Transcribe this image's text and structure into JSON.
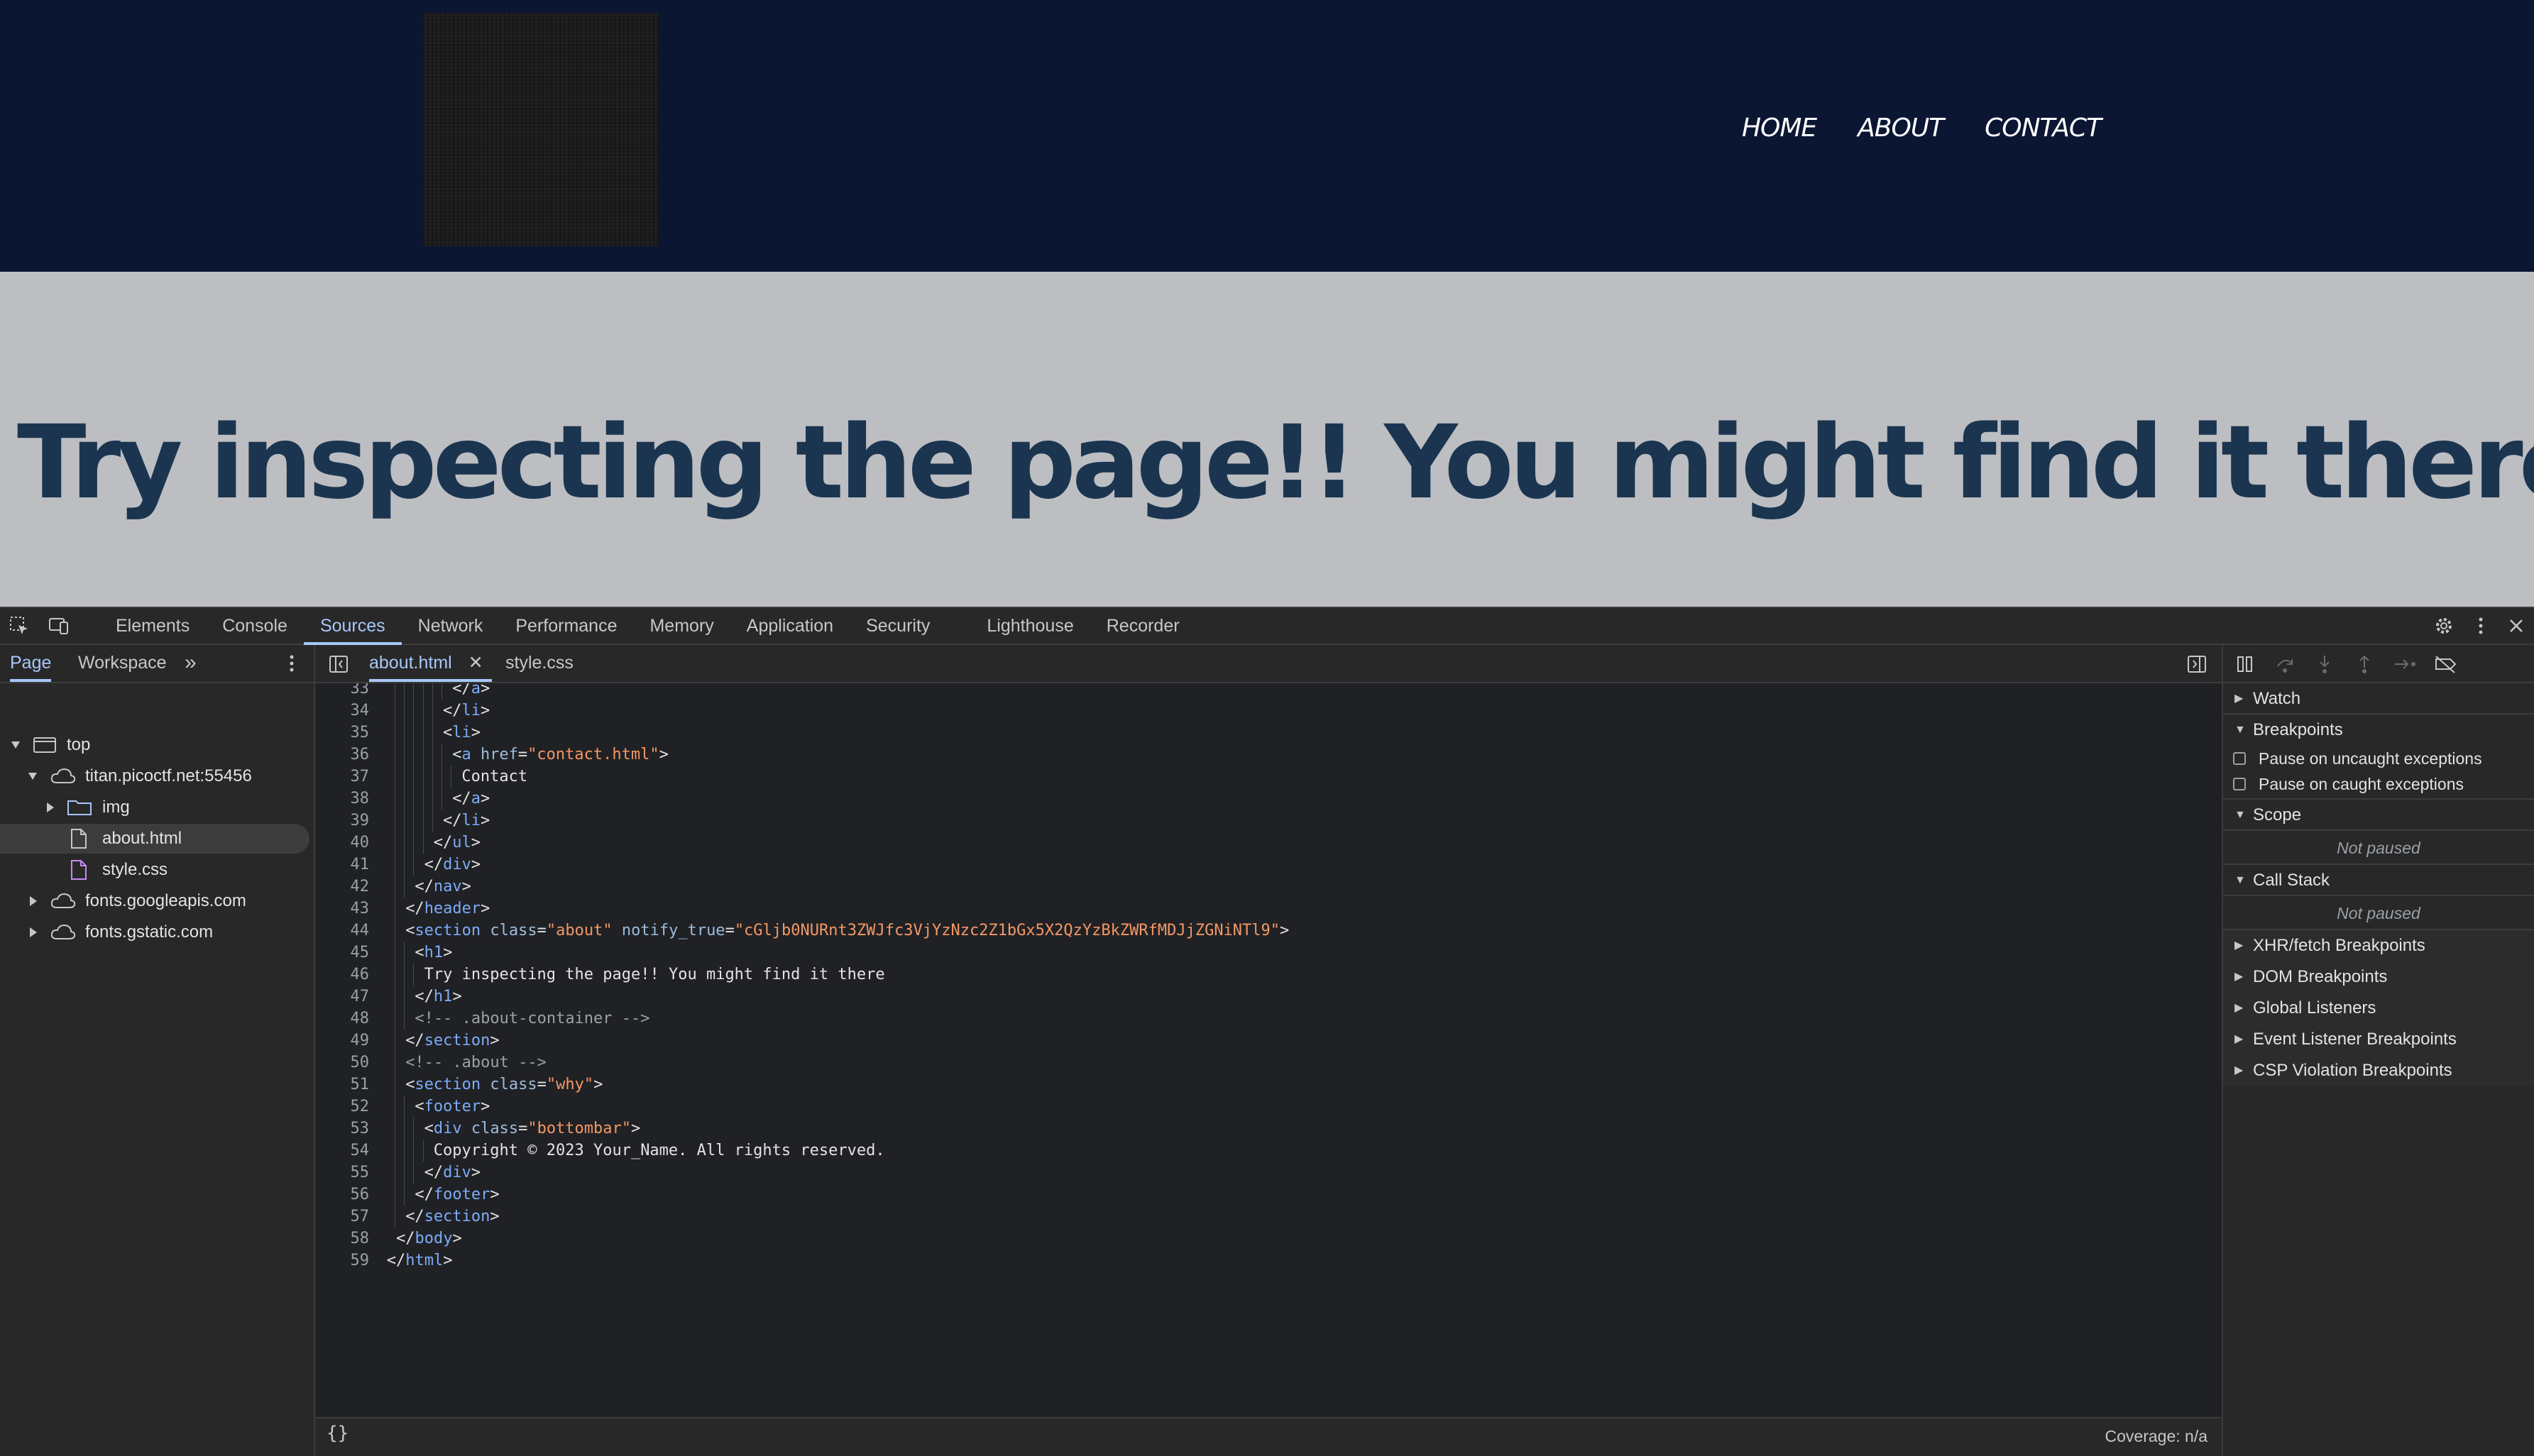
{
  "site": {
    "nav": [
      "HOME",
      "ABOUT",
      "CONTACT"
    ],
    "hero_title": "Try inspecting the page!! You might find it there"
  },
  "devtools": {
    "tabs": [
      "Elements",
      "Console",
      "Sources",
      "Network",
      "Performance",
      "Memory",
      "Application",
      "Security",
      "Lighthouse",
      "Recorder"
    ],
    "active_tab": "Sources",
    "navigator": {
      "tabs": [
        "Page",
        "Workspace"
      ],
      "tree": {
        "top": "top",
        "host": "titan.picoctf.net:55456",
        "img": "img",
        "about": "about.html",
        "style": "style.css",
        "googleapis": "fonts.googleapis.com",
        "gstatic": "fonts.gstatic.com"
      }
    },
    "editor": {
      "tabs": [
        "about.html",
        "style.css"
      ],
      "lines": [
        {
          "n": "33",
          "i": 6,
          "t": [
            [
              "p",
              "</"
            ],
            [
              "tag",
              "a"
            ],
            [
              "p",
              ">"
            ]
          ]
        },
        {
          "n": "34",
          "i": 5,
          "t": [
            [
              "p",
              "</"
            ],
            [
              "tag",
              "li"
            ],
            [
              "p",
              ">"
            ]
          ]
        },
        {
          "n": "35",
          "i": 5,
          "t": [
            [
              "p",
              "<"
            ],
            [
              "tag",
              "li"
            ],
            [
              "p",
              ">"
            ]
          ]
        },
        {
          "n": "36",
          "i": 6,
          "t": [
            [
              "p",
              "<"
            ],
            [
              "tag",
              "a"
            ],
            [
              "p",
              " "
            ],
            [
              "attr",
              "href"
            ],
            [
              "p",
              "="
            ],
            [
              "val",
              "\"contact.html\""
            ],
            [
              "p",
              ">"
            ]
          ]
        },
        {
          "n": "37",
          "i": 7,
          "t": [
            [
              "text",
              "Contact"
            ]
          ]
        },
        {
          "n": "38",
          "i": 6,
          "t": [
            [
              "p",
              "</"
            ],
            [
              "tag",
              "a"
            ],
            [
              "p",
              ">"
            ]
          ]
        },
        {
          "n": "39",
          "i": 5,
          "t": [
            [
              "p",
              "</"
            ],
            [
              "tag",
              "li"
            ],
            [
              "p",
              ">"
            ]
          ]
        },
        {
          "n": "40",
          "i": 4,
          "t": [
            [
              "p",
              "</"
            ],
            [
              "tag",
              "ul"
            ],
            [
              "p",
              ">"
            ]
          ]
        },
        {
          "n": "41",
          "i": 3,
          "t": [
            [
              "p",
              "</"
            ],
            [
              "tag",
              "div"
            ],
            [
              "p",
              ">"
            ]
          ]
        },
        {
          "n": "42",
          "i": 2,
          "t": [
            [
              "p",
              "</"
            ],
            [
              "tag",
              "nav"
            ],
            [
              "p",
              ">"
            ]
          ]
        },
        {
          "n": "43",
          "i": 1,
          "t": [
            [
              "p",
              "</"
            ],
            [
              "tag",
              "header"
            ],
            [
              "p",
              ">"
            ]
          ]
        },
        {
          "n": "44",
          "i": 1,
          "t": [
            [
              "p",
              "<"
            ],
            [
              "tag",
              "section"
            ],
            [
              "p",
              " "
            ],
            [
              "attr",
              "class"
            ],
            [
              "p",
              "="
            ],
            [
              "val",
              "\"about\""
            ],
            [
              "p",
              " "
            ],
            [
              "attr",
              "notify_true"
            ],
            [
              "p",
              "="
            ],
            [
              "val",
              "\"cGljb0NURnt3ZWJfc3VjYzNzc2Z1bGx5X2QzYzBkZWRfMDJjZGNiNTl9\""
            ],
            [
              "p",
              ">"
            ]
          ]
        },
        {
          "n": "45",
          "i": 2,
          "t": [
            [
              "p",
              "<"
            ],
            [
              "tag",
              "h1"
            ],
            [
              "p",
              ">"
            ]
          ]
        },
        {
          "n": "46",
          "i": 3,
          "t": [
            [
              "text",
              "Try inspecting the page!! You might find it there"
            ]
          ]
        },
        {
          "n": "47",
          "i": 2,
          "t": [
            [
              "p",
              "</"
            ],
            [
              "tag",
              "h1"
            ],
            [
              "p",
              ">"
            ]
          ]
        },
        {
          "n": "48",
          "i": 2,
          "t": [
            [
              "cmt",
              "<!-- .about-container -->"
            ]
          ]
        },
        {
          "n": "49",
          "i": 1,
          "t": [
            [
              "p",
              "</"
            ],
            [
              "tag",
              "section"
            ],
            [
              "p",
              ">"
            ]
          ]
        },
        {
          "n": "50",
          "i": 1,
          "t": [
            [
              "cmt",
              "<!-- .about -->"
            ]
          ]
        },
        {
          "n": "51",
          "i": 1,
          "t": [
            [
              "p",
              "<"
            ],
            [
              "tag",
              "section"
            ],
            [
              "p",
              " "
            ],
            [
              "attr",
              "class"
            ],
            [
              "p",
              "="
            ],
            [
              "val",
              "\"why\""
            ],
            [
              "p",
              ">"
            ]
          ]
        },
        {
          "n": "52",
          "i": 2,
          "t": [
            [
              "p",
              "<"
            ],
            [
              "tag",
              "footer"
            ],
            [
              "p",
              ">"
            ]
          ]
        },
        {
          "n": "53",
          "i": 3,
          "t": [
            [
              "p",
              "<"
            ],
            [
              "tag",
              "div"
            ],
            [
              "p",
              " "
            ],
            [
              "attr",
              "class"
            ],
            [
              "p",
              "="
            ],
            [
              "val",
              "\"bottombar\""
            ],
            [
              "p",
              ">"
            ]
          ]
        },
        {
          "n": "54",
          "i": 4,
          "t": [
            [
              "text",
              "Copyright © 2023 Your_Name. All rights reserved."
            ]
          ]
        },
        {
          "n": "55",
          "i": 3,
          "t": [
            [
              "p",
              "</"
            ],
            [
              "tag",
              "div"
            ],
            [
              "p",
              ">"
            ]
          ]
        },
        {
          "n": "56",
          "i": 2,
          "t": [
            [
              "p",
              "</"
            ],
            [
              "tag",
              "footer"
            ],
            [
              "p",
              ">"
            ]
          ]
        },
        {
          "n": "57",
          "i": 1,
          "t": [
            [
              "p",
              "</"
            ],
            [
              "tag",
              "section"
            ],
            [
              "p",
              ">"
            ]
          ]
        },
        {
          "n": "58",
          "i": 0,
          "t": [
            [
              "p",
              "</"
            ],
            [
              "tag",
              "body"
            ],
            [
              "p",
              ">"
            ]
          ]
        },
        {
          "n": "59",
          "i": -1,
          "t": [
            [
              "p",
              "</"
            ],
            [
              "tag",
              "html"
            ],
            [
              "p",
              ">"
            ]
          ]
        }
      ],
      "pretty_print_label": "{}",
      "coverage": "Coverage: n/a"
    },
    "debugger": {
      "watch": "Watch",
      "breakpoints": "Breakpoints",
      "pause_uncaught": "Pause on uncaught exceptions",
      "pause_caught": "Pause on caught exceptions",
      "scope": "Scope",
      "scope_status": "Not paused",
      "call_stack": "Call Stack",
      "call_stack_status": "Not paused",
      "xhr": "XHR/fetch Breakpoints",
      "dom": "DOM Breakpoints",
      "global": "Global Listeners",
      "event": "Event Listener Breakpoints",
      "csp": "CSP Violation Breakpoints"
    },
    "colors": {
      "accent": "#a8c7fa",
      "tag": "#7cacf8",
      "attr_value": "#f29766"
    }
  }
}
